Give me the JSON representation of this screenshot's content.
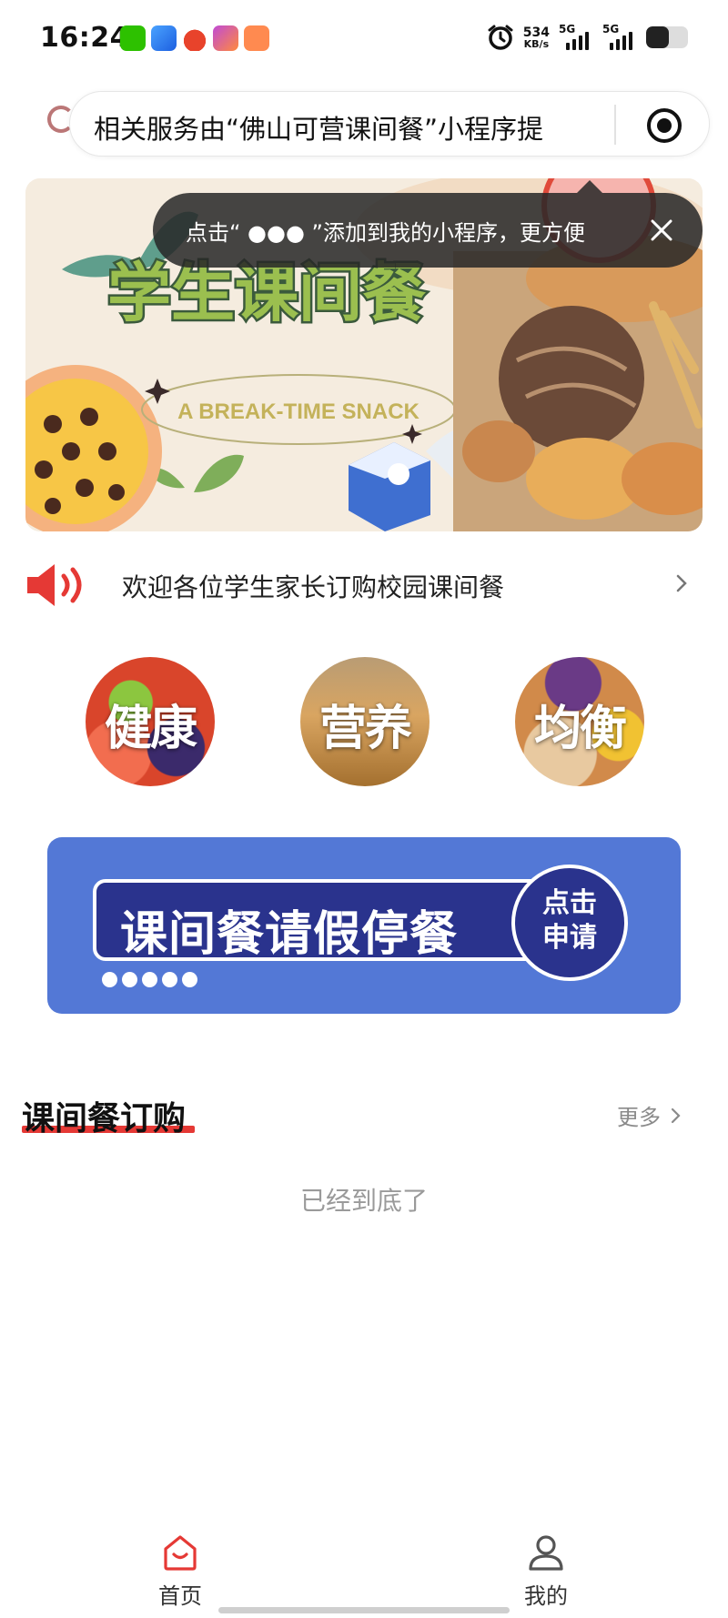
{
  "status_bar": {
    "time": "16:24",
    "speed_value": "534",
    "speed_unit": "KB/s",
    "signal_1_label": "5G",
    "signal_2_label": "5G",
    "app_icons": [
      "wechat-icon",
      "browser-icon",
      "game-icon",
      "gallery-icon",
      "shop-icon"
    ],
    "battery_level": 0.55
  },
  "capsule": {
    "text": "相关服务由“佛山可营课间餐”小程序提"
  },
  "toast": {
    "text": "点击“ ●●● ”添加到我的小程序，更方便"
  },
  "banner": {
    "title": "学生课间餐",
    "subtitle": "A BREAK-TIME SNACK"
  },
  "notice": {
    "text": "欢迎各位学生家长订购校园课间餐"
  },
  "features": [
    {
      "label": "健康"
    },
    {
      "label": "营养"
    },
    {
      "label": "均衡"
    }
  ],
  "leave_banner": {
    "title": "课间餐请假停餐",
    "cta_line1": "点击",
    "cta_line2": "申请"
  },
  "section": {
    "title": "课间餐订购",
    "more": "更多",
    "end_text": "已经到底了"
  },
  "tabbar": {
    "items": [
      {
        "label": "首页",
        "active": true
      },
      {
        "label": "我的",
        "active": false
      }
    ]
  },
  "colors": {
    "accent": "#e53935",
    "banner_blue": "#5378d6",
    "banner_navy": "#2a338d",
    "muted_text": "#9a9a9a"
  }
}
